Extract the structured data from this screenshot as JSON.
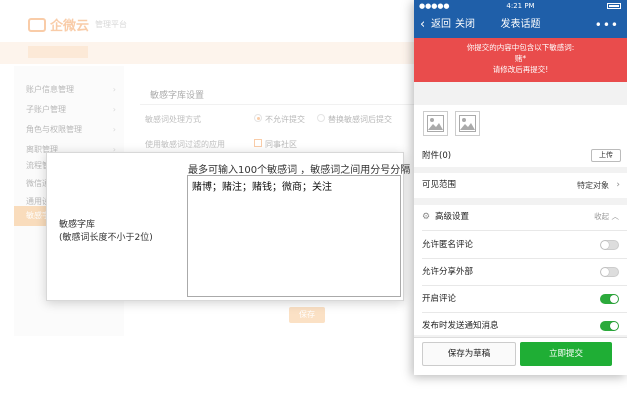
{
  "admin": {
    "logo_text": "企微云",
    "subtitle": "管理平台",
    "menu": [
      {
        "label": "账户信息管理"
      },
      {
        "label": "子账户管理"
      },
      {
        "label": "角色与权限管理"
      },
      {
        "label": "离职管理"
      },
      {
        "label": "流程管理"
      },
      {
        "label": "微信通"
      },
      {
        "label": "通用设置"
      },
      {
        "label": "敏感字"
      }
    ],
    "section_title": "敏感字库设置",
    "method_label": "敏感词处理方式",
    "method_opt1": "不允许提交",
    "method_opt2": "替换敏感词后提交",
    "apply_label": "使用敏感词过滤的应用",
    "apply_opt1": "同事社区",
    "save": "保存"
  },
  "dialog": {
    "hint": "最多可输入100个敏感词 ，敏感词之间用分号分隔",
    "label_line1": "敏感字库",
    "label_line2": "(敏感词长度不小于2位)",
    "content": "赌博；赌注；赌钱；微商；关注"
  },
  "phone": {
    "status_signal": "●●●●● ",
    "status_time": "4:21 PM",
    "nav_back": "返回",
    "nav_close": "关闭",
    "nav_title": "发表话题",
    "nav_more": "•••",
    "alert_line1": "你提交的内容中包含以下敏感词:",
    "alert_line2": "赌*",
    "alert_line3": "请修改后再提交!",
    "attachment_label": "附件(0)",
    "upload_label": "上传",
    "visible_label": "可见范围",
    "visible_value": "特定对象",
    "advanced_label": "高级设置",
    "collapse_label": "收起",
    "allow_anon": "允许匿名评论",
    "allow_share": "允许分享外部",
    "enable_comment": "开启评论",
    "notify_on_publish": "发布时发送通知消息",
    "save_draft": "保存为草稿",
    "submit_now": "立即提交"
  },
  "colors": {
    "brand_orange": "#f07b1e",
    "nav_blue": "#1f5fa9",
    "alert_red": "#e94c4c",
    "toggle_green": "#2caa3c",
    "submit_green": "#1fae35"
  },
  "toggles": {
    "allow_anon": false,
    "allow_share": false,
    "enable_comment": true,
    "notify_on_publish": true
  }
}
